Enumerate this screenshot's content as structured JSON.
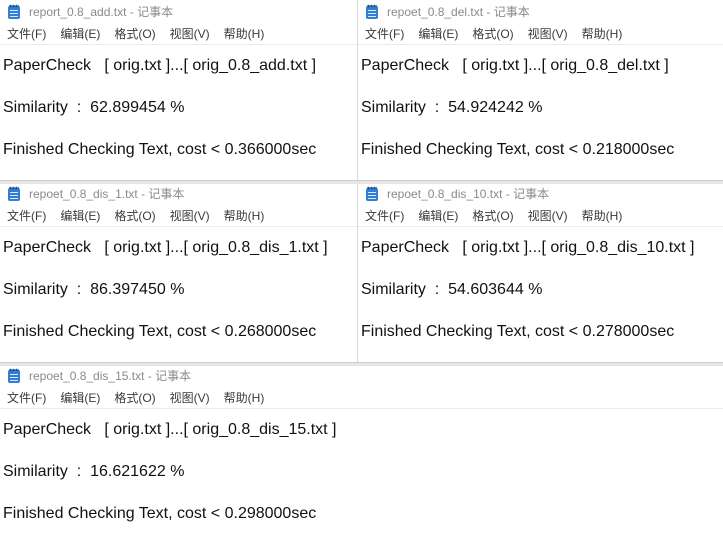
{
  "windows": [
    {
      "title": "report_0.8_add.txt - 记事本",
      "menu": [
        "文件(F)",
        "编辑(E)",
        "格式(O)",
        "视图(V)",
        "帮助(H)"
      ],
      "lines": [
        "PaperCheck   [ orig.txt ]...[ orig_0.8_add.txt ]",
        "Similarity  :  62.899454 %",
        "Finished Checking Text, cost < 0.366000sec"
      ]
    },
    {
      "title": "repoet_0.8_del.txt - 记事本",
      "menu": [
        "文件(F)",
        "编辑(E)",
        "格式(O)",
        "视图(V)",
        "帮助(H)"
      ],
      "lines": [
        "PaperCheck   [ orig.txt ]...[ orig_0.8_del.txt ]",
        "Similarity  :  54.924242 %",
        "Finished Checking Text, cost < 0.218000sec"
      ]
    },
    {
      "title": "repoet_0.8_dis_1.txt - 记事本",
      "menu": [
        "文件(F)",
        "编辑(E)",
        "格式(O)",
        "视图(V)",
        "帮助(H)"
      ],
      "lines": [
        "PaperCheck   [ orig.txt ]...[ orig_0.8_dis_1.txt ]",
        "Similarity  :  86.397450 %",
        "Finished Checking Text, cost < 0.268000sec"
      ]
    },
    {
      "title": "repoet_0.8_dis_10.txt - 记事本",
      "menu": [
        "文件(F)",
        "编辑(E)",
        "格式(O)",
        "视图(V)",
        "帮助(H)"
      ],
      "lines": [
        "PaperCheck   [ orig.txt ]...[ orig_0.8_dis_10.txt ]",
        "Similarity  :  54.603644 %",
        "Finished Checking Text, cost < 0.278000sec"
      ]
    },
    {
      "title": "repoet_0.8_dis_15.txt - 记事本",
      "menu": [
        "文件(F)",
        "编辑(E)",
        "格式(O)",
        "视图(V)",
        "帮助(H)"
      ],
      "lines": [
        "PaperCheck   [ orig.txt ]...[ orig_0.8_dis_15.txt ]",
        "Similarity  :  16.621622 %",
        "Finished Checking Text, cost < 0.298000sec"
      ]
    }
  ],
  "icons": {
    "app": "notepad-icon"
  }
}
